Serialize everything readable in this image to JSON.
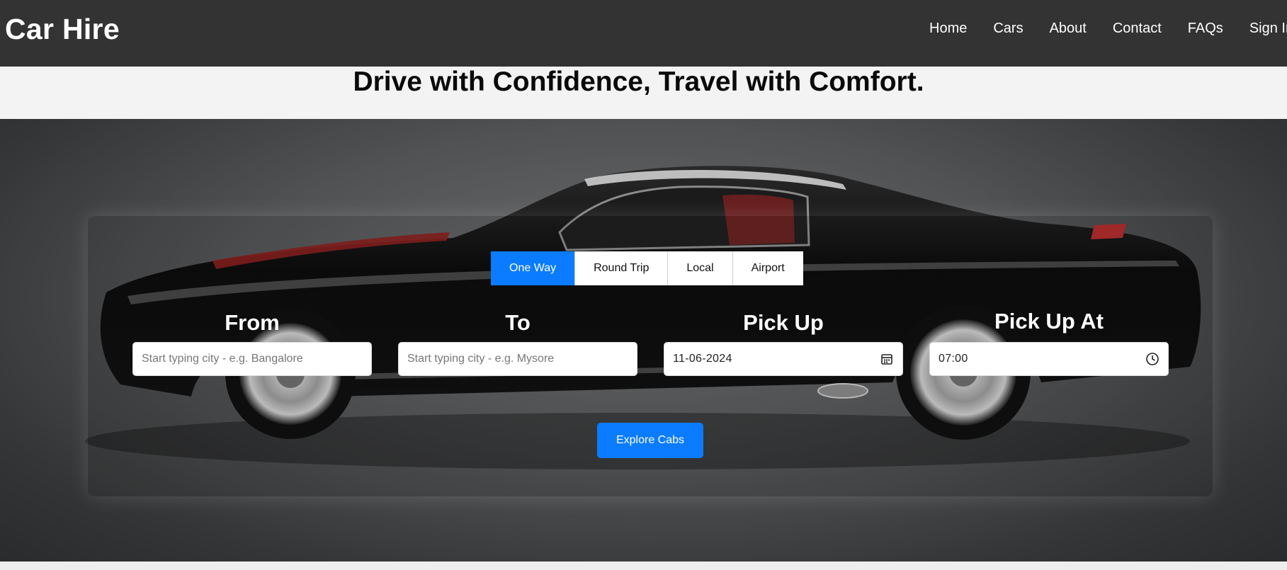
{
  "header": {
    "brand": "Car Hire",
    "nav": [
      "Home",
      "Cars",
      "About",
      "Contact",
      "FAQs",
      "Sign In"
    ]
  },
  "headline": "Drive with Confidence, Travel with Comfort.",
  "booking": {
    "tabs": [
      {
        "label": "One Way",
        "active": true
      },
      {
        "label": "Round Trip",
        "active": false
      },
      {
        "label": "Local",
        "active": false
      },
      {
        "label": "Airport",
        "active": false
      }
    ],
    "from": {
      "label": "From",
      "placeholder": "Start typing city - e.g. Bangalore"
    },
    "to": {
      "label": "To",
      "placeholder": "Start typing city - e.g. Mysore"
    },
    "pickup": {
      "label": "Pick Up",
      "value": "11-06-2024",
      "icon": "calendar-icon"
    },
    "pickup_at": {
      "label": "Pick Up At",
      "value": "07:00",
      "icon": "clock-icon"
    },
    "submit": "Explore Cabs"
  },
  "colors": {
    "header_bg": "#333333",
    "accent": "#0b7cff"
  }
}
